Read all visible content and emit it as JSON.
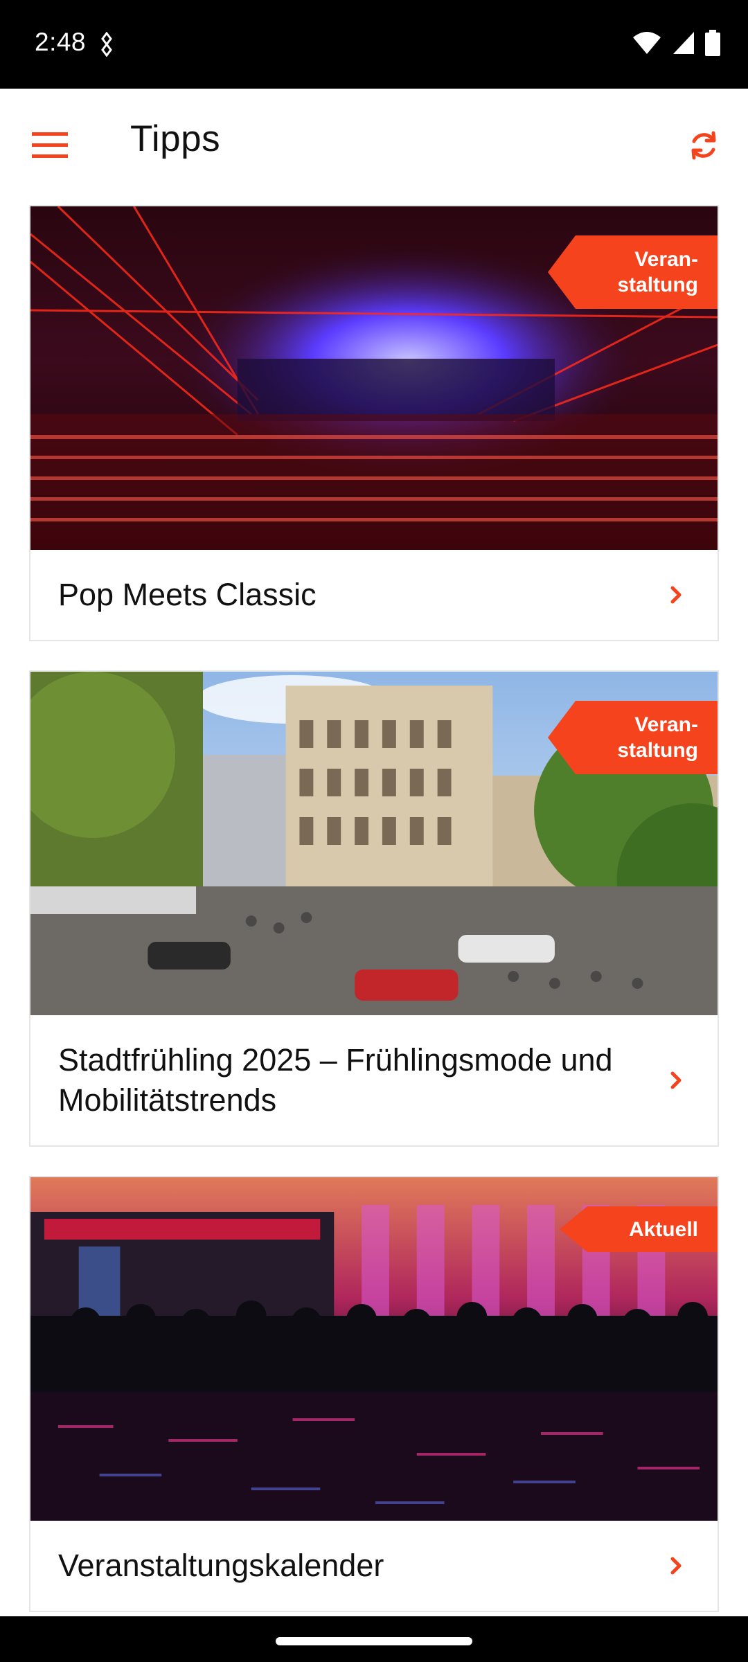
{
  "status": {
    "time": "2:48"
  },
  "header": {
    "title": "Tipps"
  },
  "cards": [
    {
      "title": "Pop Meets Classic",
      "badge": "Veran-\nstaltung"
    },
    {
      "title": "Stadtfrühling 2025 – Frühlingsmode und Mobilitätstrends",
      "badge": "Veran-\nstaltung"
    },
    {
      "title": "Veranstaltungskalender",
      "badge": "Aktuell"
    }
  ],
  "colors": {
    "accent": "#f5431d",
    "text": "#111111",
    "border": "#e5e5e5"
  }
}
